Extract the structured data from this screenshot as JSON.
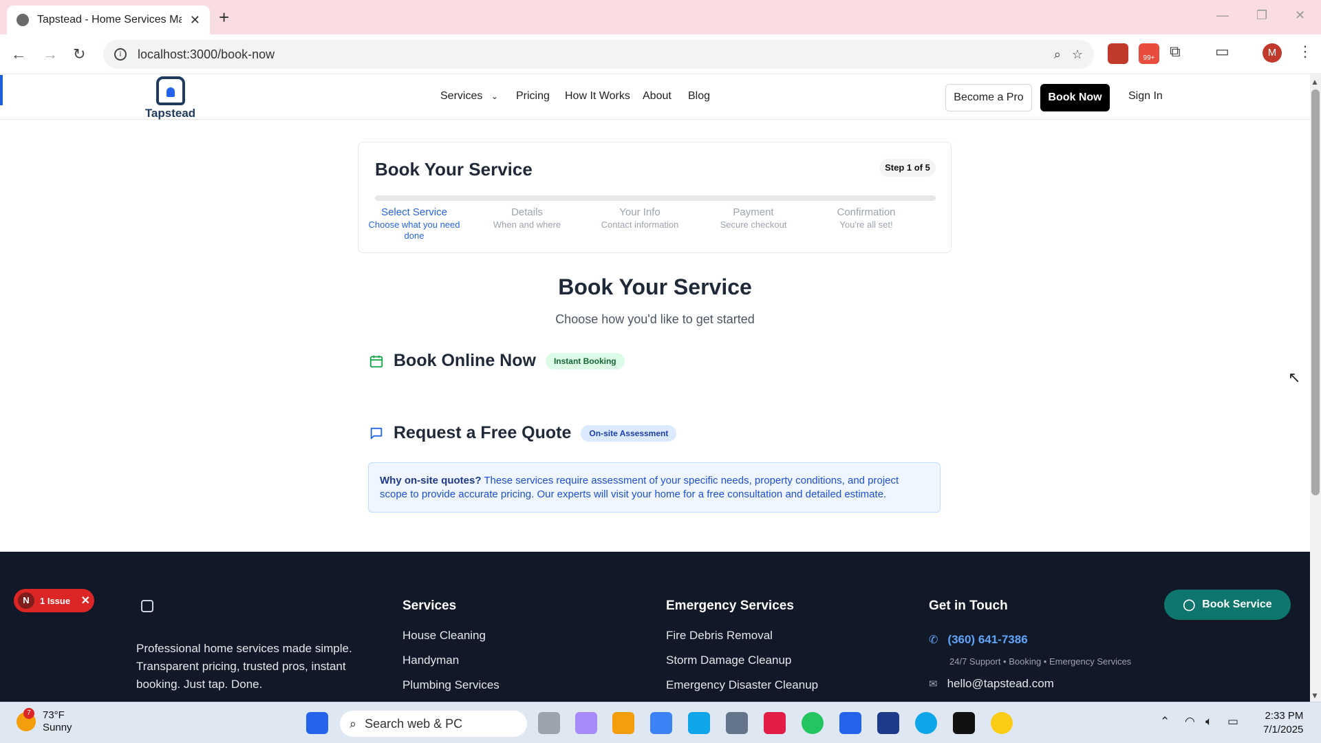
{
  "browser": {
    "tab_title": "Tapstead - Home Services Made Simple",
    "url": "localhost:3000/book-now",
    "profile_initial": "M",
    "extension_badge": "99+"
  },
  "header": {
    "logo_text": "Tapstead",
    "nav": {
      "services": "Services",
      "pricing": "Pricing",
      "how_it_works": "How It Works",
      "about": "About",
      "blog": "Blog"
    },
    "become_pro": "Become a Pro",
    "book_now": "Book Now",
    "sign_in": "Sign In"
  },
  "stepper": {
    "title": "Book Your Service",
    "step_badge": "Step 1 of 5",
    "steps": [
      {
        "label": "Select Service",
        "sub": "Choose what you need done"
      },
      {
        "label": "Details",
        "sub": "When and where"
      },
      {
        "label": "Your Info",
        "sub": "Contact information"
      },
      {
        "label": "Payment",
        "sub": "Secure checkout"
      },
      {
        "label": "Confirmation",
        "sub": "You're all set!"
      }
    ],
    "progress_fraction": 0.0
  },
  "main": {
    "title": "Book Your Service",
    "subtitle": "Choose how you'd like to get started",
    "online": {
      "title": "Book Online Now",
      "badge": "Instant Booking"
    },
    "quote": {
      "title": "Request a Free Quote",
      "badge": "On-site Assessment"
    },
    "info_bold": "Why on-site quotes?",
    "info_text": " These services require assessment of your specific needs, property conditions, and project scope to provide accurate pricing. Our experts will visit your home for a free consultation and detailed estimate."
  },
  "footer": {
    "tagline": "Professional home services made simple. Transparent pricing, trusted pros, instant booking. Just tap. Done.",
    "services_heading": "Services",
    "services": [
      "House Cleaning",
      "Handyman",
      "Plumbing Services"
    ],
    "emergency_heading": "Emergency Services",
    "emergency": [
      "Fire Debris Removal",
      "Storm Damage Cleanup",
      "Emergency Disaster Cleanup"
    ],
    "contact_heading": "Get in Touch",
    "phone": "(360) 641-7386",
    "support": "24/7 Support • Booking • Emergency Services",
    "email": "hello@tapstead.com"
  },
  "fab": {
    "label": "Book Service"
  },
  "issue": {
    "initial": "N",
    "label": "1 Issue"
  },
  "taskbar": {
    "temp": "73°F",
    "condition": "Sunny",
    "weather_badge": "7",
    "search_placeholder": "Search web & PC",
    "time": "2:33 PM",
    "date": "7/1/2025"
  },
  "colors": {
    "accent": "#2563eb",
    "footer_bg": "#111827",
    "fab": "#0f766e",
    "issue": "#dc2626"
  }
}
